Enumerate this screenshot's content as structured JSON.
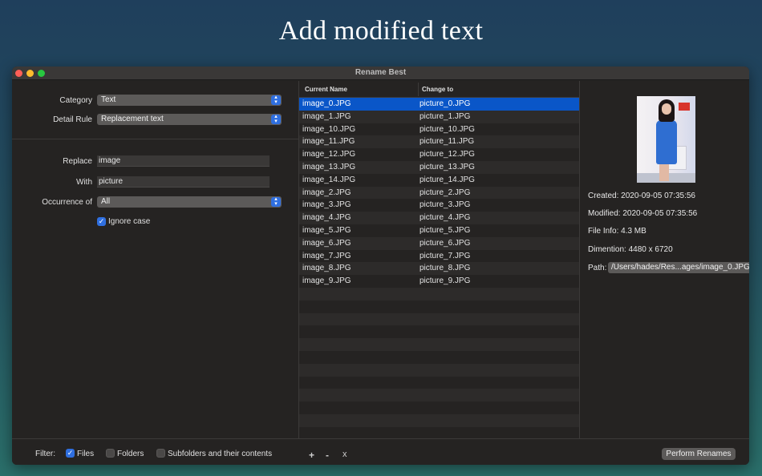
{
  "hero": {
    "title": "Add modified text"
  },
  "window": {
    "title": "Rename Best"
  },
  "rules": {
    "category_label": "Category",
    "category_value": "Text",
    "detail_rule_label": "Detail Rule",
    "detail_rule_value": "Replacement text",
    "replace_label": "Replace",
    "replace_value": "image",
    "with_label": "With",
    "with_value": "picture",
    "occurrence_label": "Occurrence of",
    "occurrence_value": "All",
    "ignore_case_label": "Ignore case",
    "ignore_case_checked": true
  },
  "table": {
    "col_current": "Current Name",
    "col_change": "Change to",
    "rows": [
      {
        "current": "image_0.JPG",
        "change": "picture_0.JPG"
      },
      {
        "current": "image_1.JPG",
        "change": "picture_1.JPG"
      },
      {
        "current": "image_10.JPG",
        "change": "picture_10.JPG"
      },
      {
        "current": "image_11.JPG",
        "change": "picture_11.JPG"
      },
      {
        "current": "image_12.JPG",
        "change": "picture_12.JPG"
      },
      {
        "current": "image_13.JPG",
        "change": "picture_13.JPG"
      },
      {
        "current": "image_14.JPG",
        "change": "picture_14.JPG"
      },
      {
        "current": "image_2.JPG",
        "change": "picture_2.JPG"
      },
      {
        "current": "image_3.JPG",
        "change": "picture_3.JPG"
      },
      {
        "current": "image_4.JPG",
        "change": "picture_4.JPG"
      },
      {
        "current": "image_5.JPG",
        "change": "picture_5.JPG"
      },
      {
        "current": "image_6.JPG",
        "change": "picture_6.JPG"
      },
      {
        "current": "image_7.JPG",
        "change": "picture_7.JPG"
      },
      {
        "current": "image_8.JPG",
        "change": "picture_8.JPG"
      },
      {
        "current": "image_9.JPG",
        "change": "picture_9.JPG"
      }
    ]
  },
  "details": {
    "created": "Created: 2020-09-05 07:35:56",
    "modified": "Modified: 2020-09-05 07:35:56",
    "file_info": "File Info: 4.3 MB",
    "dimension": "Dimention: 4480 x 6720",
    "path_label": "Path:",
    "path_value": "/Users/hades/Res...ages/image_0.JPG"
  },
  "bottom": {
    "filter_label": "Filter:",
    "files_label": "Files",
    "files_checked": true,
    "folders_label": "Folders",
    "folders_checked": false,
    "subfolders_label": "Subfolders and their contents",
    "subfolders_checked": false,
    "add_label": "+",
    "remove_label": "-",
    "clear_label": "x",
    "perform_label": "Perform Renames"
  },
  "colors": {
    "accent": "#2f6fe0",
    "selection": "#0a56c8"
  }
}
